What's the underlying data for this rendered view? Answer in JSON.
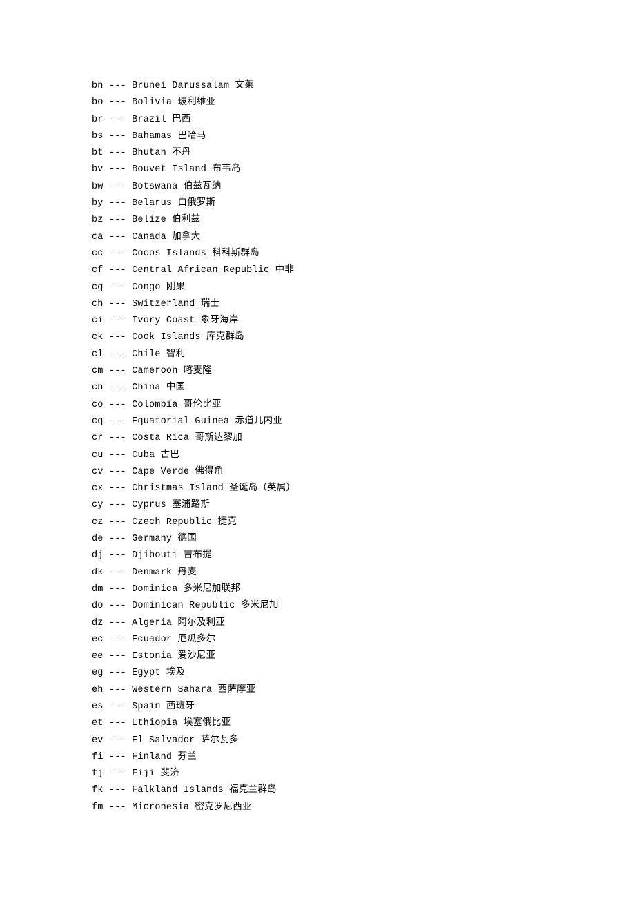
{
  "document": {
    "type": "country-code-list",
    "text_color": "#000000",
    "background_color": "#ffffff",
    "separator": "---",
    "entries": [
      {
        "code": "bn",
        "sep": "---",
        "name_en": "Brunei Darussalam",
        "name_zh": "文莱",
        "line": "bn --- Brunei Darussalam 文莱"
      },
      {
        "code": "bo",
        "sep": "---",
        "name_en": "Bolivia",
        "name_zh": "玻利维亚",
        "line": "bo --- Bolivia 玻利维亚"
      },
      {
        "code": "br",
        "sep": "---",
        "name_en": "Brazil",
        "name_zh": "巴西",
        "line": "br --- Brazil 巴西"
      },
      {
        "code": "bs",
        "sep": "---",
        "name_en": "Bahamas",
        "name_zh": "巴哈马",
        "line": "bs --- Bahamas 巴哈马"
      },
      {
        "code": "bt",
        "sep": "---",
        "name_en": "Bhutan",
        "name_zh": "不丹",
        "line": "bt --- Bhutan 不丹"
      },
      {
        "code": "bv",
        "sep": "---",
        "name_en": "Bouvet Island",
        "name_zh": "布韦岛",
        "line": "bv --- Bouvet Island 布韦岛"
      },
      {
        "code": "bw",
        "sep": "---",
        "name_en": "Botswana",
        "name_zh": "伯兹瓦纳",
        "line": "bw --- Botswana 伯兹瓦纳"
      },
      {
        "code": "by",
        "sep": "---",
        "name_en": "Belarus",
        "name_zh": "白俄罗斯",
        "line": "by --- Belarus 白俄罗斯"
      },
      {
        "code": "bz",
        "sep": "---",
        "name_en": "Belize",
        "name_zh": "伯利兹",
        "line": "bz --- Belize 伯利兹"
      },
      {
        "code": "ca",
        "sep": "---",
        "name_en": "Canada",
        "name_zh": "加拿大",
        "line": "ca --- Canada 加拿大"
      },
      {
        "code": "cc",
        "sep": "---",
        "name_en": "Cocos Islands",
        "name_zh": "科科斯群岛",
        "line": "cc --- Cocos Islands 科科斯群岛"
      },
      {
        "code": "cf",
        "sep": "---",
        "name_en": "Central African Republic",
        "name_zh": "中非",
        "line": "cf --- Central African Republic 中非"
      },
      {
        "code": "cg",
        "sep": "---",
        "name_en": "Congo",
        "name_zh": "刚果",
        "line": "cg --- Congo 刚果"
      },
      {
        "code": "ch",
        "sep": "---",
        "name_en": "Switzerland",
        "name_zh": "瑞士",
        "line": "ch --- Switzerland 瑞士"
      },
      {
        "code": "ci",
        "sep": "---",
        "name_en": "Ivory Coast",
        "name_zh": "象牙海岸",
        "line": "ci --- Ivory Coast 象牙海岸"
      },
      {
        "code": "ck",
        "sep": "---",
        "name_en": "Cook Islands",
        "name_zh": "库克群岛",
        "line": "ck --- Cook Islands 库克群岛"
      },
      {
        "code": "cl",
        "sep": "---",
        "name_en": "Chile",
        "name_zh": "智利",
        "line": "cl --- Chile 智利"
      },
      {
        "code": "cm",
        "sep": "---",
        "name_en": "Cameroon",
        "name_zh": "喀麦隆",
        "line": "cm --- Cameroon 喀麦隆"
      },
      {
        "code": "cn",
        "sep": "---",
        "name_en": "China",
        "name_zh": "中国",
        "line": "cn --- China 中国"
      },
      {
        "code": "co",
        "sep": "---",
        "name_en": "Colombia",
        "name_zh": "哥伦比亚",
        "line": "co --- Colombia 哥伦比亚"
      },
      {
        "code": "cq",
        "sep": "---",
        "name_en": "Equatorial Guinea",
        "name_zh": "赤道几内亚",
        "line": "cq --- Equatorial Guinea 赤道几内亚"
      },
      {
        "code": "cr",
        "sep": "---",
        "name_en": "Costa Rica",
        "name_zh": "哥斯达黎加",
        "line": "cr --- Costa Rica 哥斯达黎加"
      },
      {
        "code": "cu",
        "sep": "---",
        "name_en": "Cuba",
        "name_zh": "古巴",
        "line": "cu --- Cuba 古巴"
      },
      {
        "code": "cv",
        "sep": "---",
        "name_en": "Cape Verde",
        "name_zh": "佛得角",
        "line": "cv --- Cape Verde 佛得角"
      },
      {
        "code": "cx",
        "sep": "---",
        "name_en": "Christmas Island",
        "name_zh": "圣诞岛（英属）",
        "line": "cx --- Christmas Island 圣诞岛（英属）"
      },
      {
        "code": "cy",
        "sep": "---",
        "name_en": "Cyprus",
        "name_zh": "塞浦路斯",
        "line": "cy --- Cyprus 塞浦路斯"
      },
      {
        "code": "cz",
        "sep": "---",
        "name_en": "Czech Republic",
        "name_zh": "捷克",
        "line": "cz --- Czech Republic 捷克"
      },
      {
        "code": "de",
        "sep": "---",
        "name_en": "Germany",
        "name_zh": "德国",
        "line": "de --- Germany 德国"
      },
      {
        "code": "dj",
        "sep": "---",
        "name_en": "Djibouti",
        "name_zh": "吉布提",
        "line": "dj --- Djibouti 吉布提"
      },
      {
        "code": "dk",
        "sep": "---",
        "name_en": "Denmark",
        "name_zh": "丹麦",
        "line": "dk --- Denmark 丹麦"
      },
      {
        "code": "dm",
        "sep": "---",
        "name_en": "Dominica",
        "name_zh": "多米尼加联邦",
        "line": "dm --- Dominica 多米尼加联邦"
      },
      {
        "code": "do",
        "sep": "---",
        "name_en": "Dominican Republic",
        "name_zh": "多米尼加",
        "line": "do --- Dominican Republic 多米尼加"
      },
      {
        "code": "dz",
        "sep": "---",
        "name_en": "Algeria",
        "name_zh": "阿尔及利亚",
        "line": "dz --- Algeria 阿尔及利亚"
      },
      {
        "code": "ec",
        "sep": "---",
        "name_en": "Ecuador",
        "name_zh": "厄瓜多尔",
        "line": "ec --- Ecuador 厄瓜多尔"
      },
      {
        "code": "ee",
        "sep": "---",
        "name_en": "Estonia",
        "name_zh": "爱沙尼亚",
        "line": "ee --- Estonia 爱沙尼亚"
      },
      {
        "code": "eg",
        "sep": "---",
        "name_en": "Egypt",
        "name_zh": "埃及",
        "line": "eg --- Egypt 埃及"
      },
      {
        "code": "eh",
        "sep": "---",
        "name_en": "Western Sahara",
        "name_zh": "西萨摩亚",
        "line": "eh --- Western Sahara 西萨摩亚"
      },
      {
        "code": "es",
        "sep": "---",
        "name_en": "Spain",
        "name_zh": "西班牙",
        "line": "es --- Spain 西班牙"
      },
      {
        "code": "et",
        "sep": "---",
        "name_en": "Ethiopia",
        "name_zh": "埃塞俄比亚",
        "line": "et --- Ethiopia 埃塞俄比亚"
      },
      {
        "code": "ev",
        "sep": "---",
        "name_en": "El Salvador",
        "name_zh": "萨尔瓦多",
        "line": "ev --- El Salvador 萨尔瓦多"
      },
      {
        "code": "fi",
        "sep": "---",
        "name_en": "Finland",
        "name_zh": "芬兰",
        "line": "fi --- Finland 芬兰"
      },
      {
        "code": "fj",
        "sep": "---",
        "name_en": "Fiji",
        "name_zh": "斐济",
        "line": "fj --- Fiji 斐济"
      },
      {
        "code": "fk",
        "sep": "---",
        "name_en": "Falkland Islands",
        "name_zh": "福克兰群岛",
        "line": "fk --- Falkland Islands 福克兰群岛"
      },
      {
        "code": "fm",
        "sep": "---",
        "name_en": "Micronesia",
        "name_zh": "密克罗尼西亚",
        "line": "fm --- Micronesia 密克罗尼西亚"
      }
    ]
  }
}
